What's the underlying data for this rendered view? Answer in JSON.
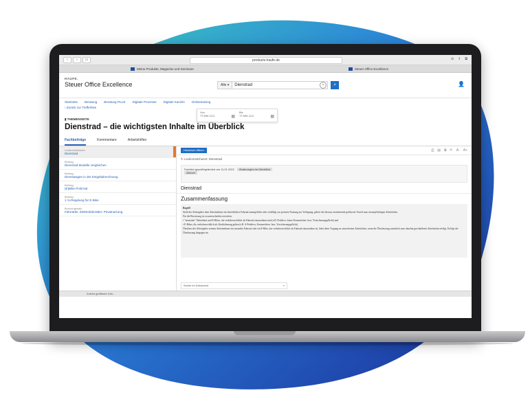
{
  "browser": {
    "address": "products.haufe.de",
    "tabs": [
      {
        "label": "Meine Produkte, Magazine und Seminare"
      },
      {
        "label": "Steuer Office Excellence"
      }
    ]
  },
  "app": {
    "brand_small": "HAUFE.",
    "brand": "Steuer Office Excellence",
    "scope": "Alle",
    "search_value": "Dienstrad",
    "nav": [
      "Startseite",
      "Beratung",
      "Beratung PLUS",
      "Digitale Prozesse",
      "Digitale Kanzlei",
      "Onlinetraining"
    ],
    "back_link": "Zurück zur Trefferliste",
    "date_from_label": "Von",
    "date_to_label": "Bis",
    "date_placeholder": "TT.MM.JJJJ"
  },
  "page": {
    "topic_label": "THEMENSEITE",
    "title": "Dienstrad – die wichtigsten Inhalte im Überblick",
    "tabs": [
      "Fachbeiträge",
      "Kommentare",
      "Arbeitshilfen"
    ]
  },
  "sidebar": [
    {
      "type": "Lexikonstichwort",
      "label": "Dienstrad"
    },
    {
      "type": "Beitrag",
      "label": "Dienstrad-Modelle vergleichen"
    },
    {
      "type": "Beitrag",
      "label": "Dienstwagen in der Entgeltabrechnung"
    },
    {
      "type": "Beitrag",
      "label": "(E)Bike-/Fahrrad"
    },
    {
      "type": "Beitrag",
      "label": "1 %-Regelung für E-Bike"
    },
    {
      "type": "Buchungssatz",
      "label": "Fahrräder, Elektrofahrräder: Privatnutzung"
    }
  ],
  "doc": {
    "button": "Historisch öffnen",
    "lexikon_link": "Lexikonstichwort: Dienstrad",
    "notice": "Fachlich geprüft/geändert am 11.01.2022",
    "notice_chip": "Änderungen im Überblick",
    "notice_chip2": "Zitieren",
    "section1": "Dienstrad",
    "section2": "Zusammenfassung",
    "text_title": "Begriff",
    "text_p1": "Stellt der Arbeitgeber dem Arbeitnehmer ein betriebliches Fahrrad unentgeltlich oder verbilligt zur privaten Nutzung zur Verfügung, gehört der hieraus resultierende geldwerte Vorteil zum steuerpflichtigen Arbeitslohn.",
    "text_p2": "Für die Bewertung ist zu unterscheiden zwischen:",
    "text_b1": "\"normalen\" Fahrrädern und E-Bikes, die verkehrsrechtlich als Fahrrad einzuordnen sind (z.B. Pedelecs; keine Kennzeichen- bzw. Versicherungspflicht) und",
    "text_b2": "E-Bikes, die verkehrsrechtlich als Kraftfahrzeug gelten (z.B. S-Pedelecs; Kennzeichen- bzw. Versicherungspflicht).",
    "text_p3": "Überlässt der Arbeitgeber seinem Arbeitnehmer ein normales Fahrrad oder ein E-Bike, das verkehrsrechtlich als Fahrrad einzuordnen ist, führt diese Vorgang zu steuerfreiem Arbeitslohn, wenn die Überlassung zusätzlich zum ohnehin geschuldeten Arbeitslohn erfolgt. Erfolgt die Überlassung hingegen im",
    "search_label": "Suche im Dokument"
  },
  "status": "Zuletzt geöffnete Dok...",
  "colors": {
    "accent": "#1f6fc5",
    "link": "#2b60b5",
    "marker": "#e07b2d"
  }
}
